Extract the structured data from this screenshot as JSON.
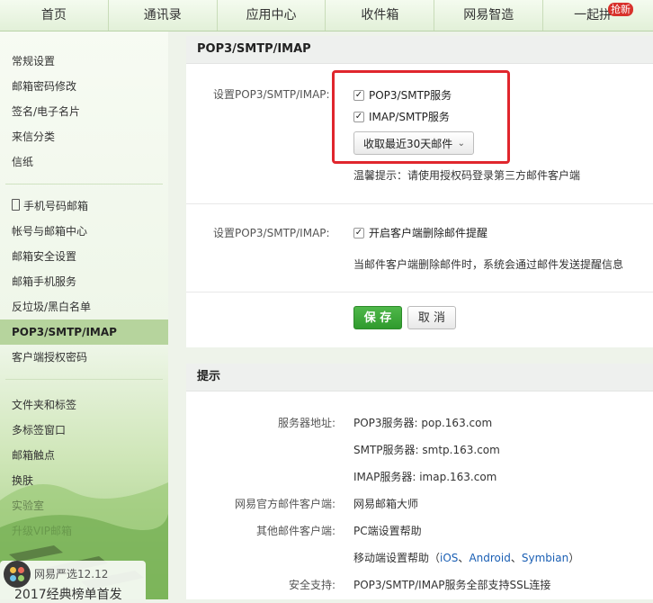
{
  "nav": {
    "tabs": [
      "首页",
      "通讯录",
      "应用中心",
      "收件箱",
      "网易智造",
      "一起拼"
    ],
    "hot_badge": "抢新"
  },
  "sidebar": {
    "group1": [
      "常规设置",
      "邮箱密码修改",
      "签名/电子名片",
      "来信分类",
      "信纸"
    ],
    "group2": [
      "手机号码邮箱",
      "帐号与邮箱中心",
      "邮箱安全设置",
      "邮箱手机服务",
      "反垃圾/黑白名单",
      "POP3/SMTP/IMAP",
      "客户端授权密码"
    ],
    "group3": [
      "文件夹和标签",
      "多标签窗口",
      "邮箱触点",
      "换肤",
      "实验室",
      "升级VIP邮箱"
    ],
    "active": "POP3/SMTP/IMAP"
  },
  "promo": {
    "line1": "网易严选12.12",
    "line2": "2017经典榜单首发"
  },
  "main": {
    "title": "POP3/SMTP/IMAP",
    "setting1_label": "设置POP3/SMTP/IMAP:",
    "pop3_smtp_label": "POP3/SMTP服务",
    "imap_smtp_label": "IMAP/SMTP服务",
    "fetch_select": "收取最近30天邮件",
    "warm_tip": "温馨提示：请使用授权码登录第三方邮件客户端",
    "setting2_label": "设置POP3/SMTP/IMAP:",
    "delete_alert_label": "开启客户端删除邮件提醒",
    "delete_alert_desc": "当邮件客户端删除邮件时，系统会通过邮件发送提醒信息",
    "save_label": "保 存",
    "cancel_label": "取 消",
    "checkmark": "✓"
  },
  "tips": {
    "title": "提示",
    "server_label": "服务器地址:",
    "pop3_server": "POP3服务器: pop.163.com",
    "smtp_server": "SMTP服务器: smtp.163.com",
    "imap_server": "IMAP服务器: imap.163.com",
    "official_client_label": "网易官方邮件客户端:",
    "official_client_link": "网易邮箱大师",
    "other_client_label": "其他邮件客户端:",
    "pc_help_link": "PC端设置帮助",
    "mobile_help_prefix": "移动端设置帮助（",
    "ios": "iOS",
    "sep1": "、",
    "android": "Android",
    "sep2": "、",
    "symbian": "Symbian",
    "mobile_help_suffix": "）",
    "security_label": "安全支持:",
    "security_value": "POP3/SMTP/IMAP服务全部支持SSL连接"
  },
  "colors": {
    "accent_green": "#3aa636",
    "highlight_red": "#e0262d",
    "link_blue": "#1a5fb4"
  }
}
